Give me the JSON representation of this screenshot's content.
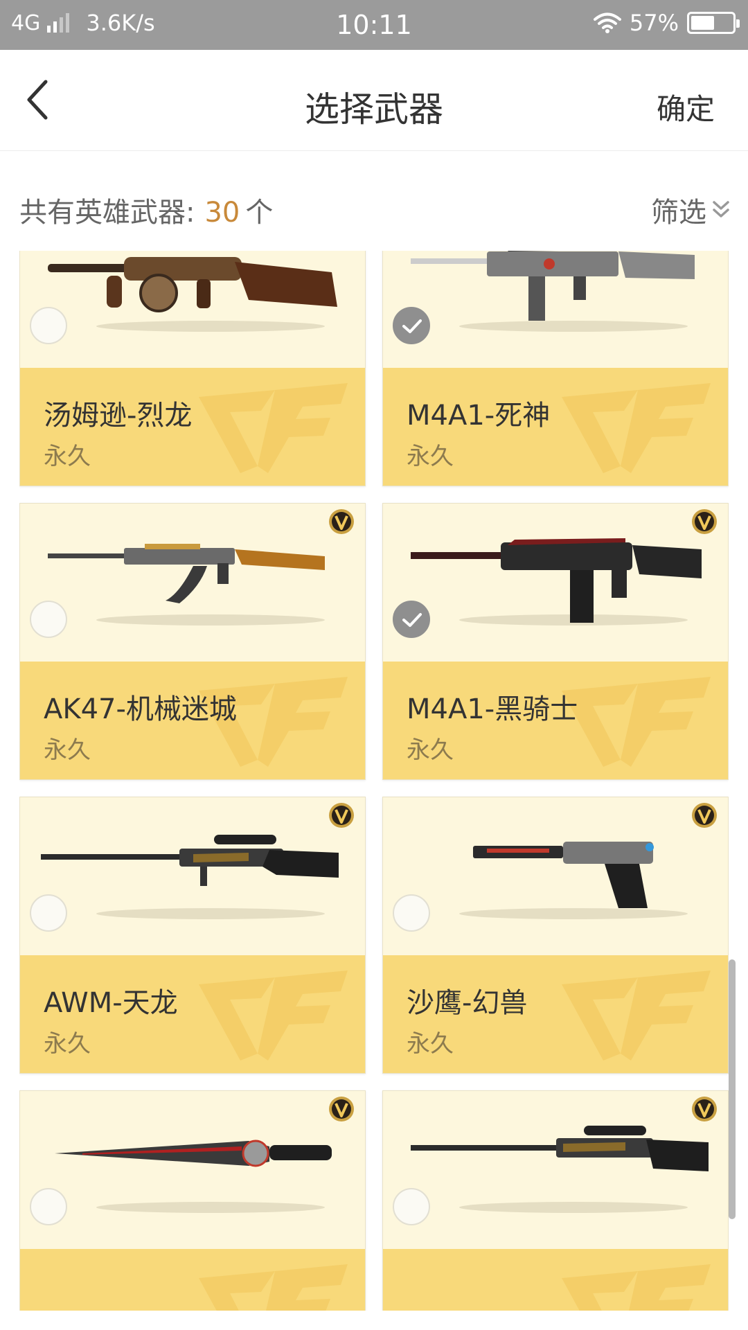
{
  "status_bar": {
    "network": "4G",
    "speed": "3.6K/s",
    "time": "10:11",
    "battery": "57%",
    "battery_level": 0.57
  },
  "header": {
    "back_icon": "chevron-left-icon",
    "title": "选择武器",
    "confirm_label": "确定"
  },
  "summary": {
    "label": "共有英雄武器:",
    "count": "30",
    "unit": "个",
    "filter_label": "筛选",
    "filter_icon": "double-chevron-down-icon"
  },
  "colors": {
    "accent_count": "#c8893a",
    "card_top": "#fdf7dd",
    "card_bottom": "#f8d97a",
    "check_selected": "#8f8f8f"
  },
  "weapons": [
    {
      "name": "汤姆逊-烈龙",
      "duration": "永久",
      "selected": false,
      "badge_icon": "vip-v-badge-icon"
    },
    {
      "name": "M4A1-死神",
      "duration": "永久",
      "selected": true,
      "badge_icon": "vip-v-badge-icon"
    },
    {
      "name": "AK47-机械迷城",
      "duration": "永久",
      "selected": false,
      "badge_icon": "vip-v-badge-icon"
    },
    {
      "name": "M4A1-黑骑士",
      "duration": "永久",
      "selected": true,
      "badge_icon": "vip-v-badge-icon"
    },
    {
      "name": "AWM-天龙",
      "duration": "永久",
      "selected": false,
      "badge_icon": "vip-v-badge-icon"
    },
    {
      "name": "沙鹰-幻兽",
      "duration": "永久",
      "selected": false,
      "badge_icon": "vip-v-badge-icon"
    },
    {
      "name": "",
      "duration": "",
      "selected": false,
      "badge_icon": "vip-v-badge-icon"
    },
    {
      "name": "",
      "duration": "",
      "selected": false,
      "badge_icon": "vip-v-badge-icon"
    }
  ]
}
